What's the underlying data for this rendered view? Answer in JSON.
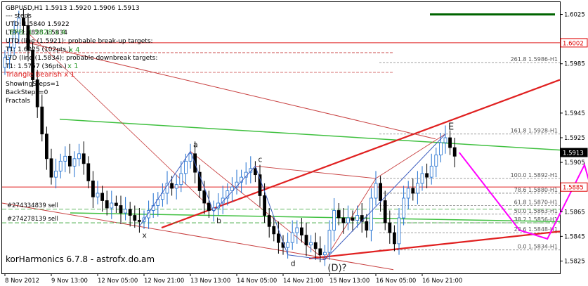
{
  "colors": {
    "frame": "#000000",
    "candle_up": "#1f6fd0",
    "candle_down": "#000000",
    "trend_red": "#e02020",
    "thin_red": "#c84040",
    "green_line": "#40c040",
    "dark_green": "#006400",
    "fib_gray": "#808080",
    "magenta": "#ff00ff",
    "price_box_red": "#e00000",
    "header_green": "#2e9c2e"
  },
  "header": {
    "symbol_line": "GBPUSD,H1  1.5913 1.5920 1.5906 1.5913",
    "steps_line": "---  steps",
    "utd_line": "UTD: 1.5840  1.5922",
    "ltd_line": "LTD: 1.5828  1.5834",
    "ltd_overlay": "EPB: 1.5828 x 4",
    "utd_long": "UTD (line (1.5921): probable break-up targets:",
    "t1_line": "T1: 1.6025 (102pts.)",
    "t1_overlay": "x 4",
    "ltd_long": "LTD (line (1.5834): probable downbreak targets:",
    "t2_line": "T1: 1.5757 (36pts.)",
    "t2_overlay": "x 1",
    "triangle_line": "Triangle Bearish x 1",
    "showing_steps": "ShowingSteps=1",
    "back_steps": "BackSteps=0",
    "fractals": "Fractals"
  },
  "footer": {
    "brand": "korHarmonics 6.7.8 - astrofx.do.am"
  },
  "orders": [
    {
      "label": "#274334839 sell",
      "price": 1.5867
    },
    {
      "label": "#274278139 sell",
      "price": 1.5856
    }
  ],
  "fib_levels": [
    {
      "label": "261.8  1.5986-H1",
      "price": 1.5986
    },
    {
      "label": "161.8  1.5928-H1",
      "price": 1.5928
    },
    {
      "label": "100.0  1.5892-H1",
      "price": 1.5892
    },
    {
      "label": "78.6  1.5880-H1",
      "price": 1.588
    },
    {
      "label": "61.8  1.5870-H1",
      "price": 1.587
    },
    {
      "label": "50.0  1.5863-H1",
      "price": 1.5863
    },
    {
      "label": "38.2  1.5856-H1",
      "price": 1.5856
    },
    {
      "label": "23.6  1.5848-H1",
      "price": 1.5848
    },
    {
      "label": "0.0  1.5834-H1",
      "price": 1.5834
    }
  ],
  "pattern_points": [
    {
      "label": "x",
      "bar": 29,
      "price": 1.5853
    },
    {
      "label": "a",
      "bar": 40,
      "price": 1.5914
    },
    {
      "label": "b",
      "bar": 45,
      "price": 1.5865
    },
    {
      "label": "c",
      "bar": 54,
      "price": 1.5902
    },
    {
      "label": "d",
      "bar": 61,
      "price": 1.583
    },
    {
      "label": "(D)?",
      "bar": 69,
      "price": 1.5826
    },
    {
      "label": "E",
      "bar": 95,
      "price": 1.5928
    }
  ],
  "chart_data": {
    "type": "candlestick",
    "symbol": "GBPUSD",
    "timeframe": "H1",
    "last_quote": {
      "open": 1.5913,
      "high": 1.592,
      "low": 1.5906,
      "close": 1.5913
    },
    "x_tick_labels": [
      "8 Nov 2012",
      "9 Nov 13:00",
      "12 Nov 05:00",
      "12 Nov 21:00",
      "13 Nov 13:00",
      "14 Nov 05:00",
      "14 Nov 21:00",
      "15 Nov 13:00",
      "16 Nov 05:00",
      "16 Nov 21:00"
    ],
    "x_tick_bars": [
      0,
      10,
      20,
      30,
      40,
      50,
      60,
      70,
      80,
      90
    ],
    "y_range": [
      1.5815,
      1.6035
    ],
    "y_ticks": [
      "1.6025",
      "1.5985",
      "1.5945",
      "1.5925",
      "1.5905",
      "1.5865",
      "1.5845",
      "1.5825"
    ],
    "y_tick_values": [
      1.6025,
      1.5985,
      1.5945,
      1.5925,
      1.5905,
      1.5865,
      1.5845,
      1.5825
    ],
    "price_boxes": [
      {
        "label": "1.6002",
        "value": 1.6002,
        "style": "red"
      },
      {
        "label": "1.5913",
        "value": 1.5913,
        "style": "black"
      },
      {
        "label": "1.5885",
        "value": 1.5885,
        "style": "red"
      }
    ],
    "closes": [
      1.599,
      1.5998,
      1.601,
      1.6022,
      1.6016,
      1.5996,
      1.5972,
      1.595,
      1.5928,
      1.5908,
      1.5893,
      1.5898,
      1.5906,
      1.591,
      1.5902,
      1.5908,
      1.5912,
      1.5904,
      1.589,
      1.5877,
      1.588,
      1.5874,
      1.5868,
      1.5872,
      1.587,
      1.5864,
      1.5867,
      1.5862,
      1.5858,
      1.5857,
      1.586,
      1.5866,
      1.587,
      1.5875,
      1.588,
      1.5888,
      1.5884,
      1.5887,
      1.5896,
      1.5906,
      1.5912,
      1.5897,
      1.5882,
      1.5872,
      1.5866,
      1.5868,
      1.5872,
      1.5876,
      1.5882,
      1.5885,
      1.5889,
      1.5893,
      1.5897,
      1.59,
      1.5895,
      1.5878,
      1.5862,
      1.5853,
      1.5847,
      1.584,
      1.5836,
      1.584,
      1.5848,
      1.5852,
      1.5846,
      1.5838,
      1.584,
      1.5835,
      1.583,
      1.5832,
      1.585,
      1.5866,
      1.586,
      1.5856,
      1.586,
      1.5858,
      1.5862,
      1.5857,
      1.585,
      1.5876,
      1.5888,
      1.5874,
      1.5856,
      1.5848,
      1.5839,
      1.586,
      1.5876,
      1.5884,
      1.588,
      1.5888,
      1.5896,
      1.5893,
      1.5902,
      1.5911,
      1.5921,
      1.5925,
      1.5917,
      1.591
    ],
    "forecast": [
      {
        "bar": 98,
        "price": 1.5913
      },
      {
        "bar": 111,
        "price": 1.585
      },
      {
        "bar": 117,
        "price": 1.5843
      },
      {
        "bar": 125,
        "price": 1.5903
      },
      {
        "bar": 131,
        "price": 1.5822
      }
    ]
  }
}
